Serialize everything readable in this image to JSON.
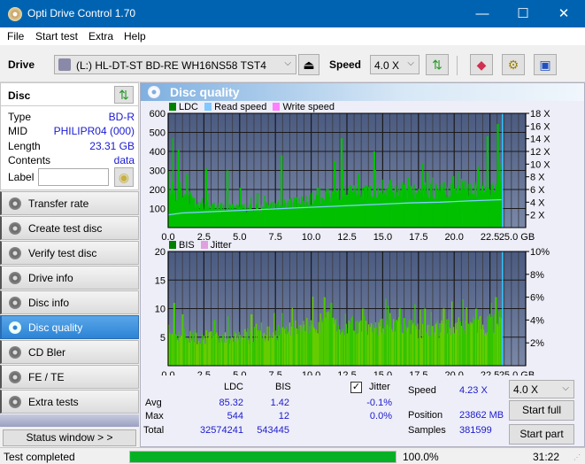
{
  "window": {
    "title": "Opti Drive Control 1.70",
    "minimize": "—",
    "maximize": "☐",
    "close": "✕"
  },
  "menu": [
    "File",
    "Start test",
    "Extra",
    "Help"
  ],
  "toolbar": {
    "drive_label": "Drive",
    "drive_value": "(L:)  HL-DT-ST BD-RE  WH16NS58 TST4",
    "speed_label": "Speed",
    "speed_value": "4.0 X"
  },
  "disc": {
    "header": "Disc",
    "rows": [
      {
        "key": "Type",
        "value": "BD-R"
      },
      {
        "key": "MID",
        "value": "PHILIPR04 (000)"
      },
      {
        "key": "Length",
        "value": "23.31 GB"
      },
      {
        "key": "Contents",
        "value": "data"
      }
    ],
    "label_key": "Label",
    "label_value": ""
  },
  "nav": [
    {
      "label": "Transfer rate",
      "active": false
    },
    {
      "label": "Create test disc",
      "active": false
    },
    {
      "label": "Verify test disc",
      "active": false
    },
    {
      "label": "Drive info",
      "active": false
    },
    {
      "label": "Disc info",
      "active": false
    },
    {
      "label": "Disc quality",
      "active": true
    },
    {
      "label": "CD Bler",
      "active": false
    },
    {
      "label": "FE / TE",
      "active": false
    },
    {
      "label": "Extra tests",
      "active": false
    }
  ],
  "status_window_button": "Status window > >",
  "main": {
    "title": "Disc quality"
  },
  "chart_data": [
    {
      "type": "area",
      "title": "LDC",
      "legend": [
        {
          "name": "LDC",
          "color": "#008000"
        },
        {
          "name": "Read speed",
          "color": "#80c8ff"
        },
        {
          "name": "Write speed",
          "color": "#ff80ff"
        }
      ],
      "xlabel": "GB",
      "x_ticks": [
        "0.0",
        "2.5",
        "5.0",
        "7.5",
        "10.0",
        "12.5",
        "15.0",
        "17.5",
        "20.0",
        "22.5",
        "25.0 GB"
      ],
      "xlim": [
        0,
        25
      ],
      "y_ticks": [
        "100",
        "200",
        "300",
        "400",
        "500",
        "600"
      ],
      "ylim": [
        0,
        600
      ],
      "y2_ticks": [
        "2 X",
        "4 X",
        "6 X",
        "8 X",
        "10 X",
        "12 X",
        "14 X",
        "16 X",
        "18 X"
      ],
      "y2lim": [
        0,
        18
      ],
      "data_end_gb": 23.31,
      "ldc_baseline": [
        [
          0,
          200
        ],
        [
          1,
          170
        ],
        [
          2,
          130
        ],
        [
          3,
          120
        ],
        [
          4,
          110
        ],
        [
          5,
          100
        ],
        [
          6,
          100
        ],
        [
          7,
          110
        ],
        [
          8,
          120
        ],
        [
          9,
          130
        ],
        [
          10,
          150
        ],
        [
          11,
          170
        ],
        [
          12,
          180
        ],
        [
          13,
          180
        ],
        [
          14,
          190
        ],
        [
          15,
          190
        ],
        [
          16,
          190
        ],
        [
          17,
          195
        ],
        [
          18,
          195
        ],
        [
          19,
          195
        ],
        [
          20,
          195
        ],
        [
          21,
          200
        ],
        [
          22,
          200
        ],
        [
          23,
          220
        ],
        [
          23.31,
          220
        ]
      ],
      "ldc_spikes": [
        [
          0.3,
          470
        ],
        [
          0.7,
          410
        ],
        [
          1.3,
          280
        ],
        [
          2.6,
          310
        ],
        [
          4.1,
          300
        ],
        [
          5.0,
          210
        ],
        [
          6.2,
          180
        ],
        [
          7.9,
          380
        ],
        [
          10.4,
          210
        ],
        [
          11.6,
          350
        ],
        [
          12.1,
          470
        ],
        [
          13.3,
          280
        ],
        [
          14.4,
          400
        ],
        [
          15.5,
          250
        ],
        [
          16.8,
          260
        ],
        [
          18.1,
          290
        ],
        [
          19.9,
          270
        ],
        [
          21.6,
          320
        ],
        [
          22.3,
          480
        ],
        [
          23.0,
          544
        ]
      ],
      "read_speed": [
        [
          0,
          2.0
        ],
        [
          1,
          2.3
        ],
        [
          3,
          2.5
        ],
        [
          5,
          2.7
        ],
        [
          7,
          2.9
        ],
        [
          9,
          3.1
        ],
        [
          11,
          3.3
        ],
        [
          13,
          3.5
        ],
        [
          15,
          3.7
        ],
        [
          17,
          3.9
        ],
        [
          19,
          4.0
        ],
        [
          21,
          4.2
        ],
        [
          23.31,
          4.4
        ]
      ]
    },
    {
      "type": "bar",
      "title": "BIS",
      "legend": [
        {
          "name": "BIS",
          "color": "#008000"
        },
        {
          "name": "Jitter",
          "color": "#e0a0e0"
        }
      ],
      "xlabel": "GB",
      "x_ticks": [
        "0.0",
        "2.5",
        "5.0",
        "7.5",
        "10.0",
        "12.5",
        "15.0",
        "17.5",
        "20.0",
        "22.5",
        "25.0 GB"
      ],
      "xlim": [
        0,
        25
      ],
      "y_ticks": [
        "5",
        "10",
        "15",
        "20"
      ],
      "ylim": [
        0,
        20
      ],
      "y2_ticks": [
        "2%",
        "4%",
        "6%",
        "8%",
        "10%"
      ],
      "y2lim": [
        0,
        10
      ],
      "data_end_gb": 23.31,
      "bis_baseline": [
        [
          0,
          6
        ],
        [
          2,
          5
        ],
        [
          4,
          5
        ],
        [
          6,
          5
        ],
        [
          8,
          6
        ],
        [
          10,
          7
        ],
        [
          11,
          8
        ],
        [
          12,
          7
        ],
        [
          14,
          7
        ],
        [
          16,
          7
        ],
        [
          18,
          6
        ],
        [
          20,
          7
        ],
        [
          22,
          7
        ],
        [
          23.31,
          8
        ]
      ],
      "bis_spikes": [
        [
          0.4,
          11
        ],
        [
          1.0,
          9
        ],
        [
          3.2,
          8
        ],
        [
          5.8,
          9
        ],
        [
          10.9,
          12
        ],
        [
          11.4,
          11
        ],
        [
          13.6,
          10
        ],
        [
          16.2,
          10
        ],
        [
          17.9,
          10
        ],
        [
          19.2,
          10
        ],
        [
          21.5,
          10
        ],
        [
          22.9,
          12
        ]
      ]
    }
  ],
  "stats": {
    "col_ldc": "LDC",
    "col_bis": "BIS",
    "jitter_label": "Jitter",
    "jitter_checked": true,
    "rows": [
      {
        "label": "Avg",
        "ldc": "85.32",
        "bis": "1.42",
        "jitter": "-0.1%"
      },
      {
        "label": "Max",
        "ldc": "544",
        "bis": "12",
        "jitter": "0.0%"
      },
      {
        "label": "Total",
        "ldc": "32574241",
        "bis": "543445",
        "jitter": ""
      }
    ],
    "speed_label": "Speed",
    "speed_value": "4.23 X",
    "position_label": "Position",
    "position_value": "23862 MB",
    "samples_label": "Samples",
    "samples_value": "381599",
    "speed_select": "4.0 X",
    "start_full": "Start full",
    "start_part": "Start part"
  },
  "statusbar": {
    "text": "Test completed",
    "progress_percent": 100,
    "progress_label": "100.0%",
    "time": "31:22"
  }
}
